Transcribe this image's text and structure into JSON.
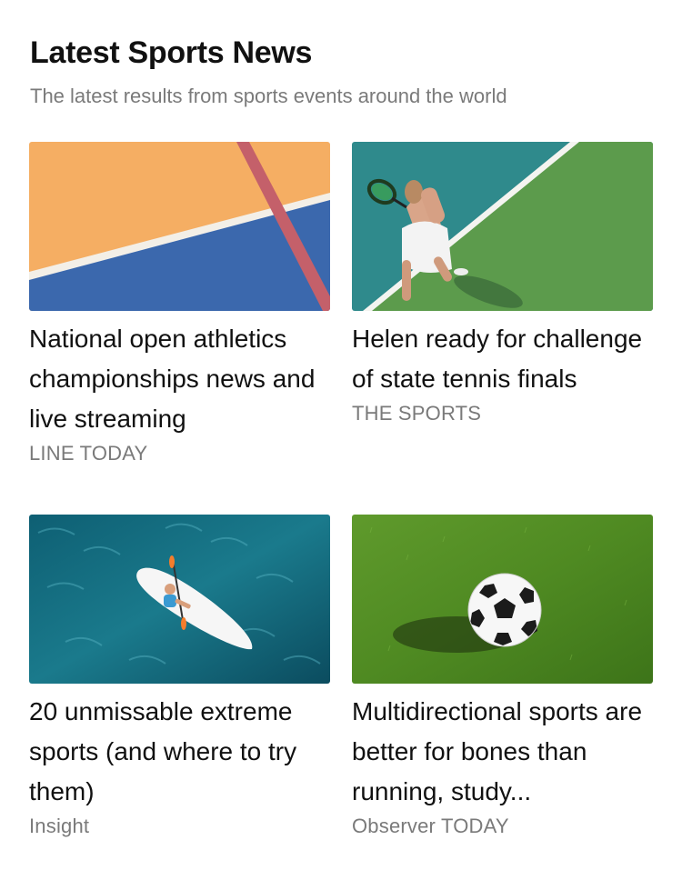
{
  "header": {
    "title": "Latest Sports News",
    "subtitle": "The latest results from sports events around the world"
  },
  "articles": [
    {
      "headline": "National open athletics championships news and live streaming",
      "source": "LINE TODAY",
      "image": "athletics-track-image"
    },
    {
      "headline": "Helen ready for challenge of state tennis finals",
      "source": "THE SPORTS",
      "image": "tennis-player-image"
    },
    {
      "headline": "20 unmissable extreme sports (and where to try them)",
      "source": "Insight",
      "image": "kayak-on-water-image"
    },
    {
      "headline": "Multidirectional sports are better for bones than running, study...",
      "source": "Observer TODAY",
      "image": "soccer-ball-on-grass-image"
    }
  ]
}
